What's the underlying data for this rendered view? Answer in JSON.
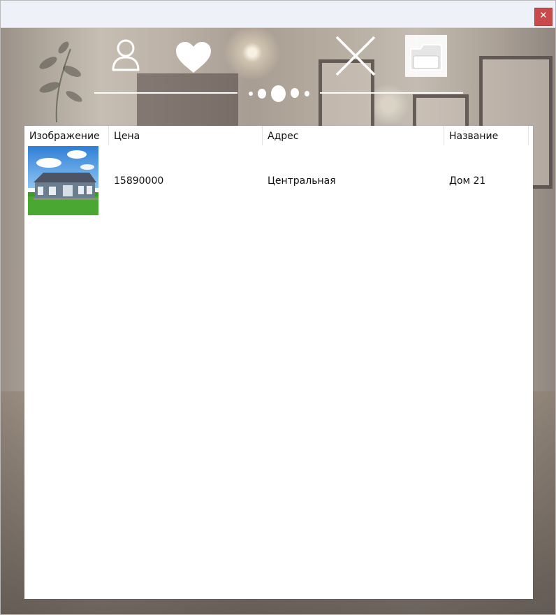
{
  "window": {
    "close_glyph": "✕"
  },
  "nav": {
    "icons": [
      "user-icon",
      "heart-icon",
      "close-icon",
      "folder-icon"
    ],
    "carousel_dots": 5
  },
  "table": {
    "columns": [
      "Изображение",
      "Цена",
      "Адрес",
      "Название"
    ],
    "rows": [
      {
        "image": "house-thumbnail",
        "price": "15890000",
        "address": "Центральная",
        "name": "Дом 21"
      }
    ]
  },
  "colors": {
    "title_bar": "#eef1f7",
    "close_button": "#c94a4a",
    "panel": "#ffffff",
    "icon": "#ffffff"
  }
}
